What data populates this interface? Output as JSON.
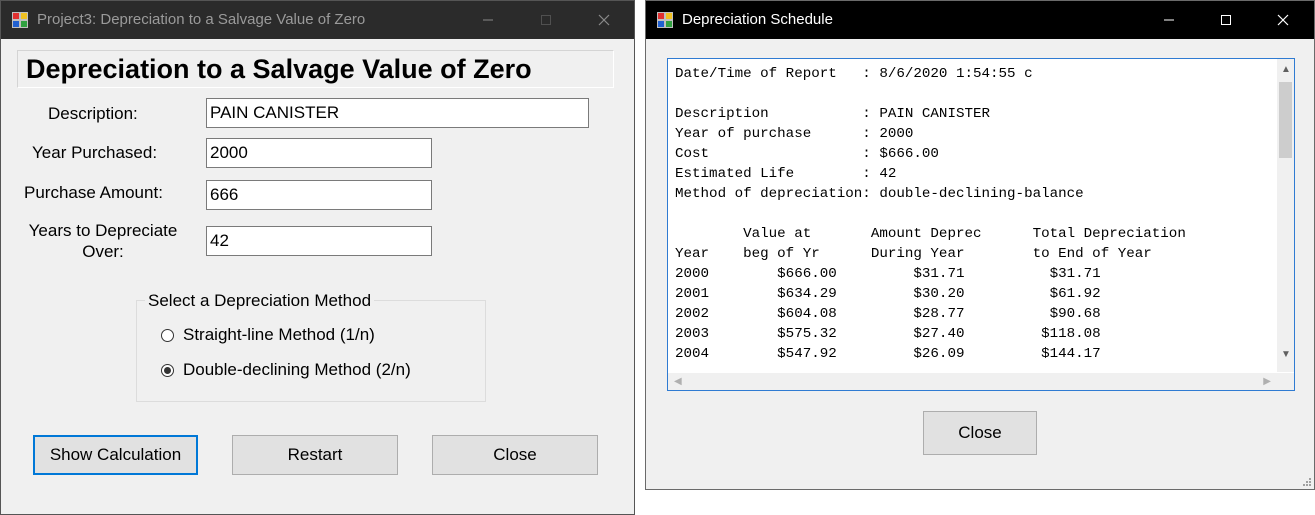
{
  "main_window": {
    "title": "Project3: Depreciation to a Salvage Value of Zero",
    "heading": "Depreciation to a Salvage Value of Zero",
    "fields": {
      "description": {
        "label": "Description:",
        "value": "PAIN CANISTER"
      },
      "year_purchased": {
        "label": "Year Purchased:",
        "value": "2000"
      },
      "purchase_amount": {
        "label": "Purchase Amount:",
        "value": "666"
      },
      "years_depreciate": {
        "label_line1": "Years to Depreciate",
        "label_line2": "Over:",
        "value": "42"
      }
    },
    "method_group": {
      "title": "Select a Depreciation Method",
      "options": [
        {
          "label": "Straight-line Method (1/n)",
          "checked": false
        },
        {
          "label": "Double-declining Method (2/n)",
          "checked": true
        }
      ]
    },
    "buttons": {
      "show": "Show Calculation",
      "restart": "Restart",
      "close": "Close"
    }
  },
  "schedule_window": {
    "title": "Depreciation Schedule",
    "report": {
      "date_label": "Date/Time of Report   : 8/6/2020 1:54:55 c",
      "summary": [
        "Description           : PAIN CANISTER",
        "Year of purchase      : 2000",
        "Cost                  : $666.00",
        "Estimated Life        : 42",
        "Method of depreciation: double-declining-balance"
      ],
      "header_line1": "        Value at       Amount Deprec      Total Depreciation",
      "header_line2": "Year    beg of Yr      During Year        to End of Year",
      "rows": [
        "2000        $666.00         $31.71          $31.71",
        "2001        $634.29         $30.20          $61.92",
        "2002        $604.08         $28.77          $90.68",
        "2003        $575.32         $27.40         $118.08",
        "2004        $547.92         $26.09         $144.17"
      ]
    },
    "close_button": "Close"
  }
}
